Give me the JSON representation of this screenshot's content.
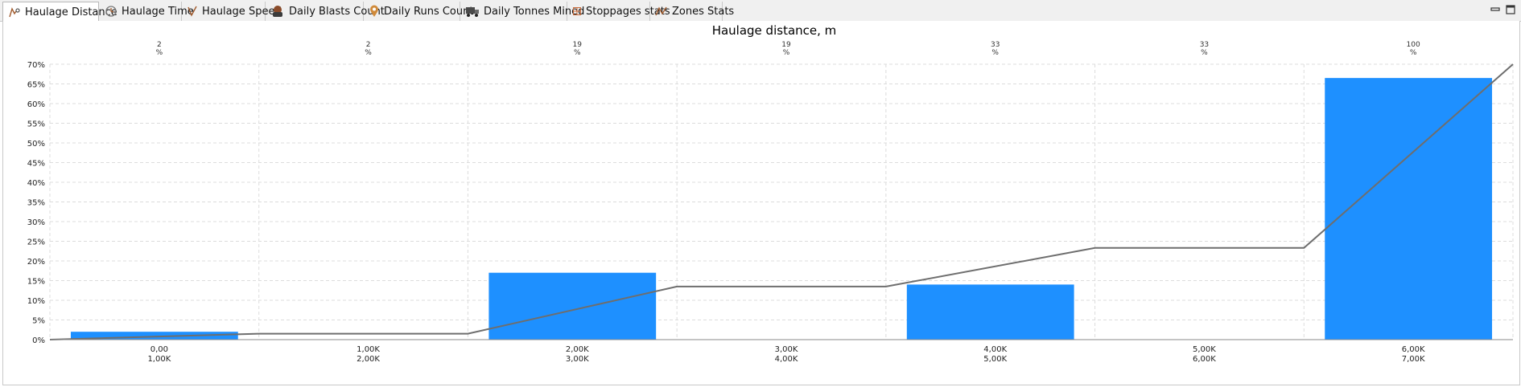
{
  "tabs": [
    {
      "label": "Haulage Distance",
      "icon": "haulage-distance-icon",
      "active": true
    },
    {
      "label": "Haulage Time",
      "icon": "clock-icon",
      "active": false
    },
    {
      "label": "Haulage Speed",
      "icon": "speed-icon",
      "active": false
    },
    {
      "label": "Daily Blasts Count",
      "icon": "explosion-icon",
      "active": false
    },
    {
      "label": "Daily Runs Count",
      "icon": "location-pin-icon",
      "active": false
    },
    {
      "label": "Daily Tonnes Mined",
      "icon": "truck-icon",
      "active": false
    },
    {
      "label": "Stoppages stats",
      "icon": "grid-icon",
      "active": false
    },
    {
      "label": "Zones Stats",
      "icon": "zigzag-icon",
      "active": false
    }
  ],
  "colors": {
    "bar": "#1e90ff",
    "line": "#6e6e6e",
    "grid": "#dcdcdc"
  },
  "chart_data": {
    "type": "bar",
    "title": "Haulage distance, m",
    "categories": [
      [
        "0,00",
        "1,00K"
      ],
      [
        "1,00K",
        "2,00K"
      ],
      [
        "2,00K",
        "3,00K"
      ],
      [
        "3,00K",
        "4,00K"
      ],
      [
        "4,00K",
        "5,00K"
      ],
      [
        "5,00K",
        "6,00K"
      ],
      [
        "6,00K",
        "7,00K"
      ]
    ],
    "series": [
      {
        "type": "bar",
        "values": [
          2,
          0,
          17,
          0,
          14,
          0,
          66.5
        ]
      },
      {
        "type": "line",
        "values": [
          1.5,
          1.5,
          13.5,
          13.5,
          23.3,
          23.3,
          70
        ]
      }
    ],
    "top_labels": [
      [
        "2",
        "%"
      ],
      [
        "2",
        "%"
      ],
      [
        "19",
        "%"
      ],
      [
        "19",
        "%"
      ],
      [
        "33",
        "%"
      ],
      [
        "33",
        "%"
      ],
      [
        "100",
        "%"
      ]
    ],
    "yticks": [
      "0%",
      "5%",
      "10%",
      "15%",
      "20%",
      "25%",
      "30%",
      "35%",
      "40%",
      "45%",
      "50%",
      "55%",
      "60%",
      "65%",
      "70%"
    ],
    "ylim": [
      0,
      70
    ],
    "grid": true
  }
}
